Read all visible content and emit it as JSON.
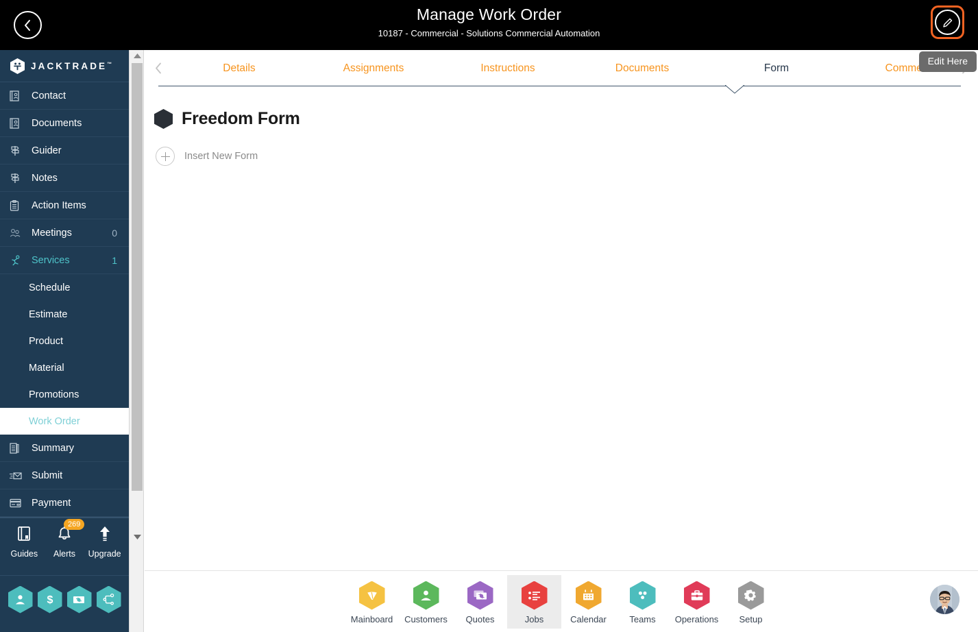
{
  "header": {
    "title": "Manage Work Order",
    "subtitle": "10187 - Commercial - Solutions Commercial Automation",
    "back_icon": "chevron-left-icon",
    "edit_icon": "pencil-icon",
    "edit_tooltip": "Edit Here",
    "accent_orange": "#f26322",
    "bg": "#000000"
  },
  "sidebar": {
    "brand": "JACKTRADE",
    "brand_tm": "™",
    "bg": "#1f3b53",
    "active_color": "#4ec3c9",
    "items": [
      {
        "label": "Contact",
        "icon": "contact-card-icon",
        "count": ""
      },
      {
        "label": "Documents",
        "icon": "document-icon",
        "count": ""
      },
      {
        "label": "Guider",
        "icon": "signpost-icon",
        "count": ""
      },
      {
        "label": "Notes",
        "icon": "signpost-icon",
        "count": ""
      },
      {
        "label": "Action Items",
        "icon": "clipboard-icon",
        "count": ""
      },
      {
        "label": "Meetings",
        "icon": "meetings-icon",
        "count": "0"
      },
      {
        "label": "Services",
        "icon": "services-icon",
        "count": "1"
      }
    ],
    "sub_items": [
      {
        "label": "Schedule"
      },
      {
        "label": "Estimate"
      },
      {
        "label": "Product"
      },
      {
        "label": "Material"
      },
      {
        "label": "Promotions"
      },
      {
        "label": "Work Order"
      }
    ],
    "items_after": [
      {
        "label": "Summary",
        "icon": "summary-icon",
        "count": ""
      },
      {
        "label": "Submit",
        "icon": "submit-mail-icon",
        "count": ""
      },
      {
        "label": "Payment",
        "icon": "payment-card-icon",
        "count": ""
      }
    ],
    "quick": [
      {
        "label": "Guides",
        "icon": "book-icon",
        "badge": ""
      },
      {
        "label": "Alerts",
        "icon": "bell-icon",
        "badge": "269"
      },
      {
        "label": "Upgrade",
        "icon": "up-arrow-icon",
        "badge": ""
      }
    ],
    "hex_buttons": [
      {
        "name": "user-hex-button",
        "icon": "person-icon",
        "color": "#4dbdbd"
      },
      {
        "name": "money-hex-button",
        "icon": "dollar-icon",
        "color": "#4dbdbd"
      },
      {
        "name": "transfer-hex-button",
        "icon": "money-exchange-icon",
        "color": "#4dbdbd"
      },
      {
        "name": "workflow-hex-button",
        "icon": "workflow-icon",
        "color": "#4dbdbd"
      }
    ],
    "badge_color": "#f5a623"
  },
  "tabs": {
    "prev_icon": "chevron-left-icon",
    "next_icon": "chevron-right-icon",
    "items": [
      {
        "label": "Details",
        "active": false
      },
      {
        "label": "Assignments",
        "active": false
      },
      {
        "label": "Instructions",
        "active": false
      },
      {
        "label": "Documents",
        "active": false
      },
      {
        "label": "Form",
        "active": true
      },
      {
        "label": "Comments",
        "active": false
      }
    ],
    "color": "#f7941e",
    "active_color": "#27374a"
  },
  "main": {
    "form_title": "Freedom Form",
    "form_icon": "hexagon-icon",
    "insert_label": "Insert New Form",
    "insert_icon": "plus-circle-icon"
  },
  "bottom_nav": {
    "items": [
      {
        "label": "Mainboard",
        "icon": "mainboard-icon",
        "color": "#f5c242",
        "active": false
      },
      {
        "label": "Customers",
        "icon": "person-icon",
        "color": "#5cb85c",
        "active": false
      },
      {
        "label": "Quotes",
        "icon": "quote-bill-icon",
        "color": "#9b68c4",
        "active": false
      },
      {
        "label": "Jobs",
        "icon": "list-icon",
        "color": "#e8413f",
        "active": true
      },
      {
        "label": "Calendar",
        "icon": "calendar-icon",
        "color": "#f0a830",
        "active": false
      },
      {
        "label": "Teams",
        "icon": "teams-dots-icon",
        "color": "#4dbdbd",
        "active": false
      },
      {
        "label": "Operations",
        "icon": "briefcase-icon",
        "color": "#e03b58",
        "active": false
      },
      {
        "label": "Setup",
        "icon": "gear-icon",
        "color": "#9a9a9a",
        "active": false
      }
    ],
    "avatar": "user-avatar"
  }
}
